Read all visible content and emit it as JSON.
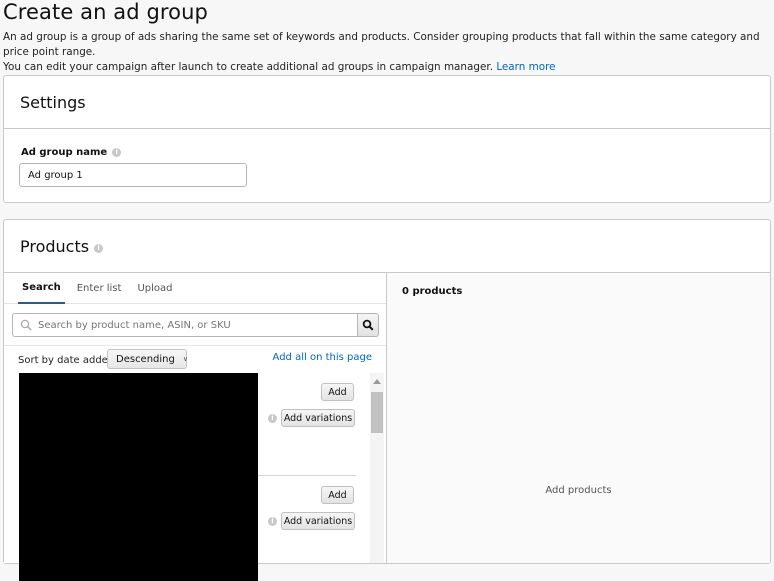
{
  "page": {
    "title": "Create an ad group",
    "description_line1": "An ad group is a group of ads sharing the same set of keywords and products. Consider grouping products that fall within the same category and price point range.",
    "description_line2": "You can edit your campaign after launch to create additional ad groups in campaign manager.",
    "learn_more": "Learn more"
  },
  "settings": {
    "title": "Settings",
    "ad_group_name_label": "Ad group name",
    "ad_group_name_value": "Ad group 1",
    "info_icon": "info-icon"
  },
  "products": {
    "title": "Products",
    "tabs": [
      {
        "label": "Search",
        "active": true
      },
      {
        "label": "Enter list",
        "active": false
      },
      {
        "label": "Upload",
        "active": false
      }
    ],
    "search_placeholder": "Search by product name, ASIN, or SKU",
    "sort_label": "Sort by date added",
    "sort_value": "Descending",
    "add_all_link": "Add all on this page",
    "items": [
      {
        "add_label": "Add",
        "add_variations_label": "Add variations"
      },
      {
        "add_label": "Add",
        "add_variations_label": "Add variations"
      }
    ],
    "selected_count": "0 products",
    "empty_hint": "Add products"
  }
}
